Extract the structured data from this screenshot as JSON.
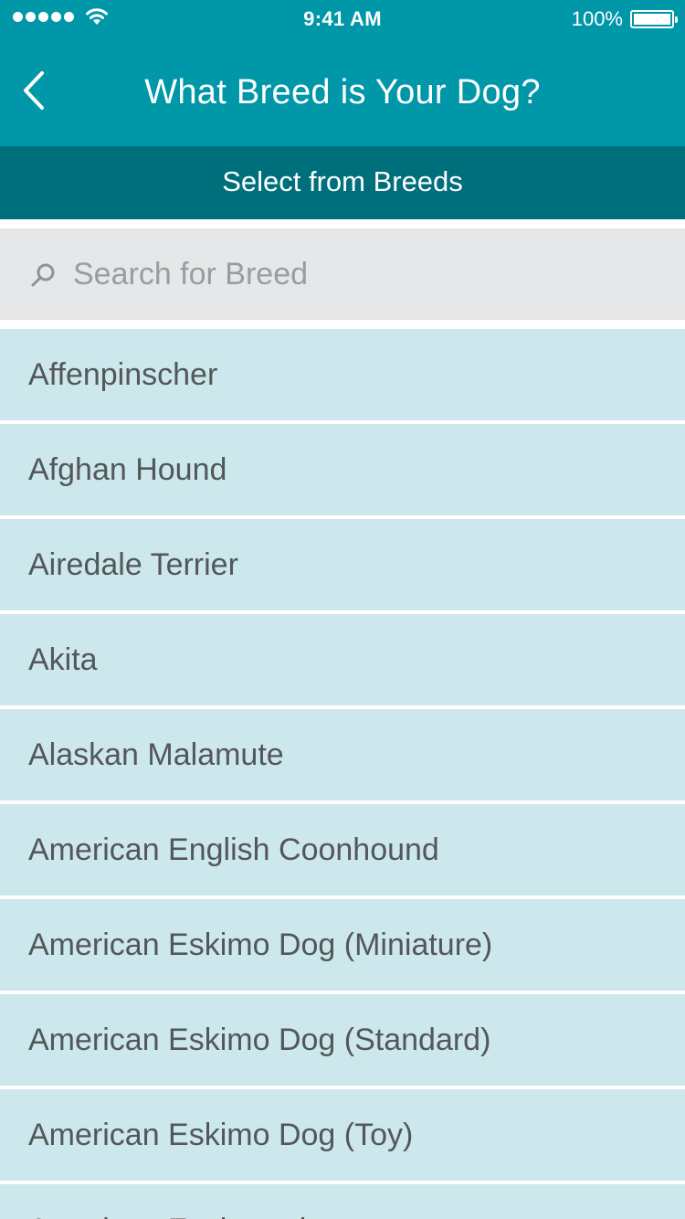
{
  "status_bar": {
    "time": "9:41 AM",
    "battery_percent": "100%",
    "signal_bars": 5,
    "icons": [
      "signal-dots-icon",
      "wifi-icon",
      "battery-icon"
    ]
  },
  "nav": {
    "title": "What Breed is Your Dog?",
    "back_icon": "chevron-left-icon"
  },
  "subheader": {
    "label": "Select from Breeds"
  },
  "search": {
    "placeholder": "Search for Breed",
    "value": "",
    "icon": "search-icon"
  },
  "breeds": [
    "Affenpinscher",
    "Afghan Hound",
    "Airedale Terrier",
    "Akita",
    "Alaskan Malamute",
    "American English Coonhound",
    "American Eskimo Dog (Miniature)",
    "American Eskimo Dog (Standard)",
    "American Eskimo Dog (Toy)",
    "American Foxhound"
  ],
  "colors": {
    "header": "#0097a8",
    "subheader": "#006f7c",
    "search_bg": "#e6e7e8",
    "row_bg": "#cde8ec",
    "row_text": "#53575a"
  }
}
